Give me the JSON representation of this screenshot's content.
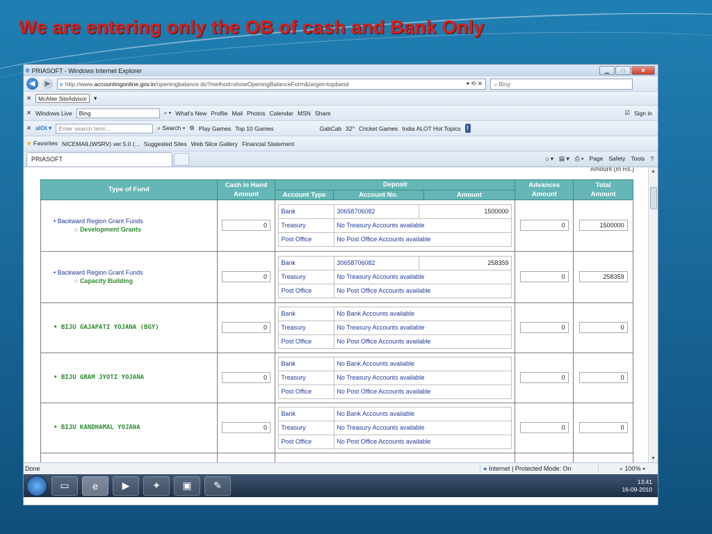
{
  "slide": {
    "title": "We are entering only the OB of cash and Bank Only"
  },
  "browser": {
    "window_title": "PRIASOFT - Windows Internet Explorer",
    "url_prefix": "http://www.",
    "url_host": "accountingonline.gov.in",
    "url_path": "/openingbalance.do?method=showOpeningBalanceForm&target=topband",
    "search_placeholder": "Bing",
    "mcafee": "McAfee SiteAdvisor",
    "live_toolbar": {
      "brand": "Windows Live",
      "search_value": "Bing",
      "links": [
        "What's New",
        "Profile",
        "Mail",
        "Photos",
        "Calendar",
        "MSN",
        "Share"
      ],
      "sign_in": "Sign in"
    },
    "alot_toolbar": {
      "search_placeholder": "Enter search term...",
      "search_label": "Search",
      "items": [
        "Play Games",
        "Top 10 Games",
        "GabCab",
        "32°",
        "Cricket Games",
        "India ALOT Hot Topics"
      ]
    },
    "favorites": {
      "label": "Favorites",
      "items": [
        "NICEMAIL(WSRV) ver 5.0 (...",
        "Suggested Sites",
        "Web Slice Gallery",
        "Financial Statement"
      ]
    },
    "tab_label": "PRIASOFT",
    "commands": [
      "Page",
      "Safety",
      "Tools"
    ],
    "status": {
      "left": "Done",
      "zone": "Internet | Protected Mode: On",
      "zoom": "100%"
    }
  },
  "form": {
    "amount_note": "Amount (In Rs.)",
    "headers": {
      "type_of_fund": "Type of Fund",
      "cash_in_hand": "Cash in Hand",
      "cash_amount": "Amount",
      "deposit": "Deposit",
      "account_type": "Account Type",
      "account_no": "Account No.",
      "amount": "Amount",
      "advances": "Advances",
      "advances_amount": "Amount",
      "total": "Total",
      "total_amount": "Amount"
    },
    "rows": [
      {
        "fund": "Backward Region Grant Funds",
        "sub": "Development Grants",
        "cash": "0",
        "bank": {
          "type": "Bank",
          "account": "30658706082",
          "amount": "1500000"
        },
        "treasury": {
          "type": "Treasury",
          "text": "No Treasury Accounts available"
        },
        "post": {
          "type": "Post Office",
          "text": "No Post Office Accounts available"
        },
        "advances": "0",
        "total": "1500000"
      },
      {
        "fund": "Backward Region Grant Funds",
        "sub": "Capacity Building",
        "cash": "0",
        "bank": {
          "type": "Bank",
          "account": "30658706082",
          "amount": "258359"
        },
        "treasury": {
          "type": "Treasury",
          "text": "No Treasury Accounts available"
        },
        "post": {
          "type": "Post Office",
          "text": "No Post Office Accounts available"
        },
        "advances": "0",
        "total": "258359"
      },
      {
        "fund": "BIJU GAJAPATI YOJANA (BGY)",
        "cash": "0",
        "bank": {
          "type": "Bank",
          "text": "No Bank Accounts available"
        },
        "treasury": {
          "type": "Treasury",
          "text": "No Treasury Accounts available"
        },
        "post": {
          "type": "Post Office",
          "text": "No Post Office Accounts available"
        },
        "advances": "0",
        "total": "0"
      },
      {
        "fund": "BIJU GRAM JYOTI YOJANA",
        "cash": "0",
        "bank": {
          "type": "Bank",
          "text": "No Bank Accounts available"
        },
        "treasury": {
          "type": "Treasury",
          "text": "No Treasury Accounts available"
        },
        "post": {
          "type": "Post Office",
          "text": "No Post Office Accounts available"
        },
        "advances": "0",
        "total": "0"
      },
      {
        "fund": "BIJU KANDHAMAL YOJANA",
        "cash": "0",
        "bank": {
          "type": "Bank",
          "text": "No Bank Accounts available"
        },
        "treasury": {
          "type": "Treasury",
          "text": "No Treasury Accounts available"
        },
        "post": {
          "type": "Post Office",
          "text": "No Post Office Accounts available"
        },
        "advances": "0",
        "total": "0"
      }
    ]
  },
  "taskbar": {
    "time": "13:41",
    "date": "16-09-2010"
  }
}
